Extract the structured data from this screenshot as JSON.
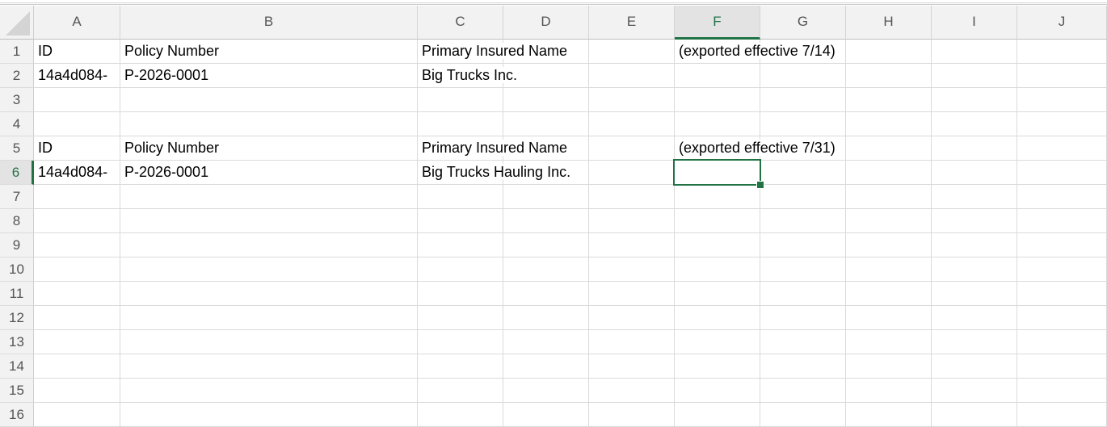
{
  "columns": [
    "A",
    "B",
    "C",
    "D",
    "E",
    "F",
    "G",
    "H",
    "I",
    "J"
  ],
  "active_column": "F",
  "rows": [
    "1",
    "2",
    "3",
    "4",
    "5",
    "6",
    "7",
    "8",
    "9",
    "10",
    "11",
    "12",
    "13",
    "14",
    "15",
    "16"
  ],
  "active_row": "6",
  "active_cell": "F6",
  "cells": {
    "A1": "ID",
    "B1": "Policy Number",
    "C1": "Primary Insured Name",
    "F1": "(exported effective 7/14)",
    "A2": "14a4d084-",
    "B2": "P-2026-0001",
    "C2": "Big Trucks Inc.",
    "A5": "ID",
    "B5": "Policy Number",
    "C5": "Primary Insured Name",
    "F5": "(exported effective 7/31)",
    "A6": "14a4d084-",
    "B6": "P-2026-0001",
    "C6": "Big Trucks Hauling Inc."
  },
  "colors": {
    "accent": "#217346",
    "header_bg": "#f2f2f2",
    "gridline": "#dadada"
  }
}
